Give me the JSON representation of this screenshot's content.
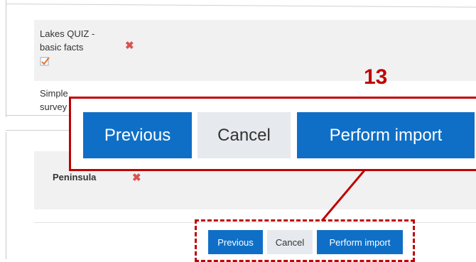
{
  "quiz_item": {
    "title": "Lakes QUIZ - basic facts"
  },
  "survey_item": {
    "title": "Simple survey"
  },
  "peninsula_item": {
    "title": "Peninsula"
  },
  "step_number": "13",
  "buttons": {
    "previous": "Previous",
    "cancel": "Cancel",
    "perform_import": "Perform import"
  },
  "colors": {
    "primary": "#0f6fc6",
    "secondary": "#e6e9ed",
    "highlight_red": "#c00000",
    "delete_red": "#d9534f"
  },
  "icons": [
    "delete-x-icon",
    "checkbox-checked-icon"
  ]
}
